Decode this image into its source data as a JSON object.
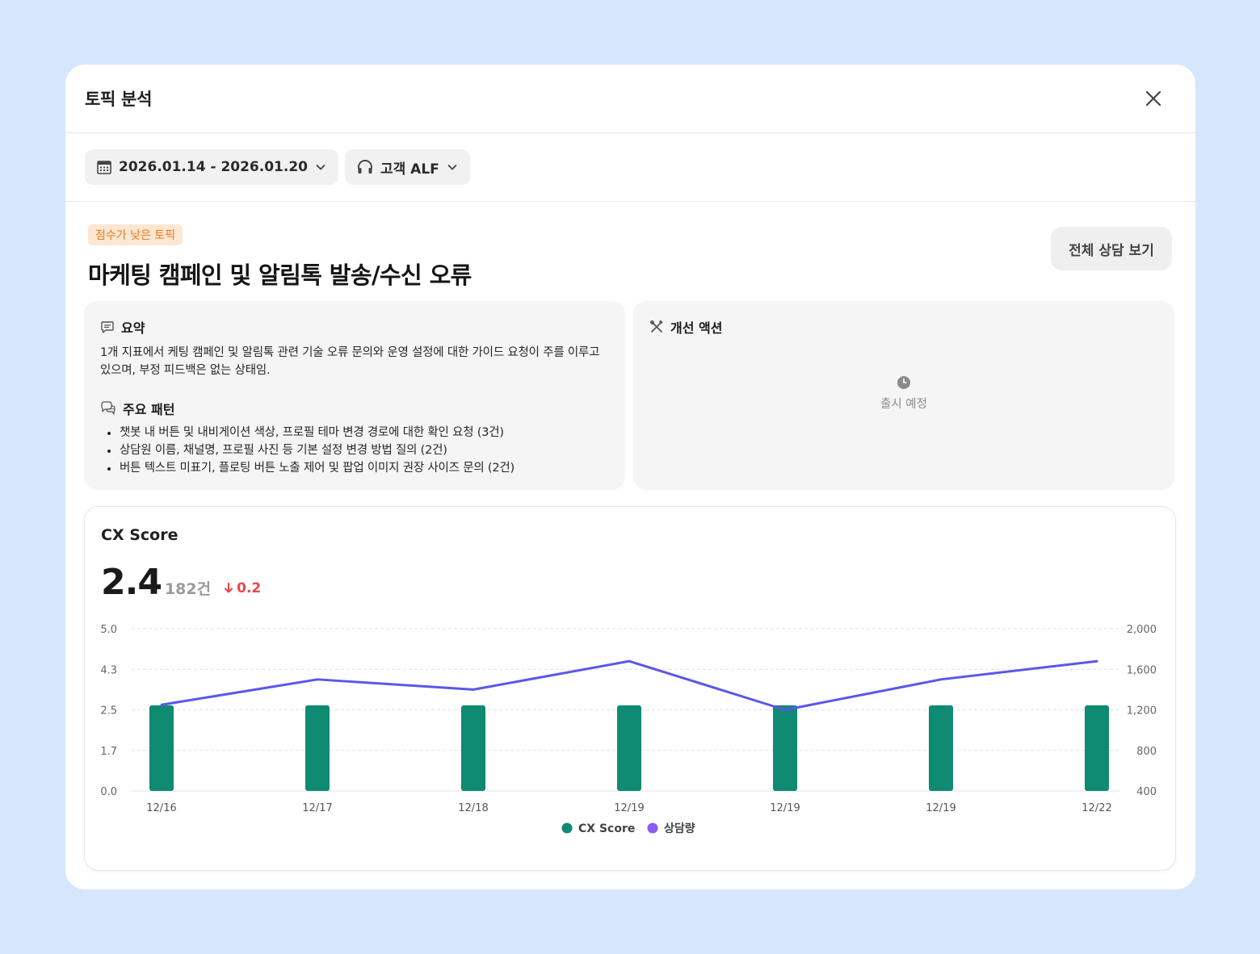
{
  "modal": {
    "title": "토픽 분석"
  },
  "filters": {
    "date_range": "2026.01.14 - 2026.01.20",
    "agent": "고객 ALF"
  },
  "topic": {
    "badge": "점수가 낮은 토픽",
    "title": "마케팅 캠페인 및 알림톡 발송/수신 오류",
    "view_all_label": "전체 상담 보기"
  },
  "summary": {
    "heading": "요약",
    "text": "1개 지표에서 케팅 캠페인 및 알림톡 관련 기술 오류 문의와 운영 설정에 대한 가이드 요청이 주를 이루고 있으며, 부정 피드백은 없는 상태임.",
    "patterns_heading": "주요 패턴",
    "patterns": [
      "챗봇 내 버튼 및 내비게이션 색상, 프로필 테마 변경 경로에 대한 확인 요청 (3건)",
      "상담원 이름, 채널명, 프로필 사진 등 기본 설정 변경 방법 질의 (2건)",
      "버튼 텍스트 미표기, 플로팅 버튼 노출 제어 및 팝업 이미지 권장 사이즈 문의 (2건)"
    ]
  },
  "actions": {
    "heading": "개선 액션",
    "status": "출시 예정"
  },
  "cx": {
    "title": "CX Score",
    "score": "2.4",
    "count": "182건",
    "delta": "0.2"
  },
  "colors": {
    "bar": "#0f8a73",
    "line": "#5b57e8",
    "negative": "#e5484d",
    "badge_text": "#f07a1a"
  },
  "chart_data": {
    "type": "bar+line",
    "categories": [
      "12/16",
      "12/17",
      "12/18",
      "12/19",
      "12/19",
      "12/19",
      "12/22"
    ],
    "series": [
      {
        "name": "CX Score",
        "type": "bar",
        "axis": "left",
        "values": [
          2.7,
          2.7,
          2.7,
          2.7,
          2.7,
          2.7,
          2.7
        ]
      },
      {
        "name": "상담량",
        "type": "line",
        "axis": "right",
        "values": [
          1250,
          1500,
          1400,
          1680,
          1200,
          1500,
          1680
        ]
      }
    ],
    "y_left": {
      "ticks": [
        "0.0",
        "1.7",
        "2.5",
        "4.3",
        "5.0"
      ],
      "tick_values": [
        0,
        1.7,
        2.5,
        4.3,
        5.0
      ]
    },
    "y_right": {
      "ticks": [
        "400",
        "800",
        "1,200",
        "1,600",
        "2,000"
      ],
      "tick_values": [
        400,
        800,
        1200,
        1600,
        2000
      ]
    },
    "grid": true,
    "legend": "bottom-center"
  }
}
